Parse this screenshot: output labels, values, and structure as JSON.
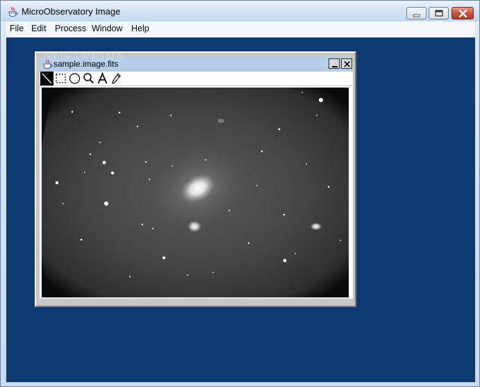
{
  "window": {
    "title": "MicroObservatory Image",
    "icon": "java-cup-icon",
    "controls": [
      "minimize",
      "maximize",
      "close"
    ]
  },
  "menubar": {
    "items": [
      "File",
      "Edit",
      "Process",
      "Window",
      "Help"
    ]
  },
  "watermark": "SOFTPEDIA",
  "image_window": {
    "title": "sample.image.fits",
    "icon": "java-cup-icon",
    "controls": [
      "minimize",
      "close"
    ],
    "tools": [
      {
        "name": "line-tool-icon",
        "selected": true
      },
      {
        "name": "rectangle-select-icon",
        "selected": false
      },
      {
        "name": "ellipse-select-icon",
        "selected": false
      },
      {
        "name": "magnifier-icon",
        "selected": false
      },
      {
        "name": "text-tool-icon",
        "selected": false
      },
      {
        "name": "pencil-tool-icon",
        "selected": false
      }
    ],
    "image_content": "grayscale galaxy star field"
  },
  "colors": {
    "desktop": "#0e3a73",
    "child_titlebar": "#b4cde9",
    "child_frame": "#c6c6c6"
  }
}
